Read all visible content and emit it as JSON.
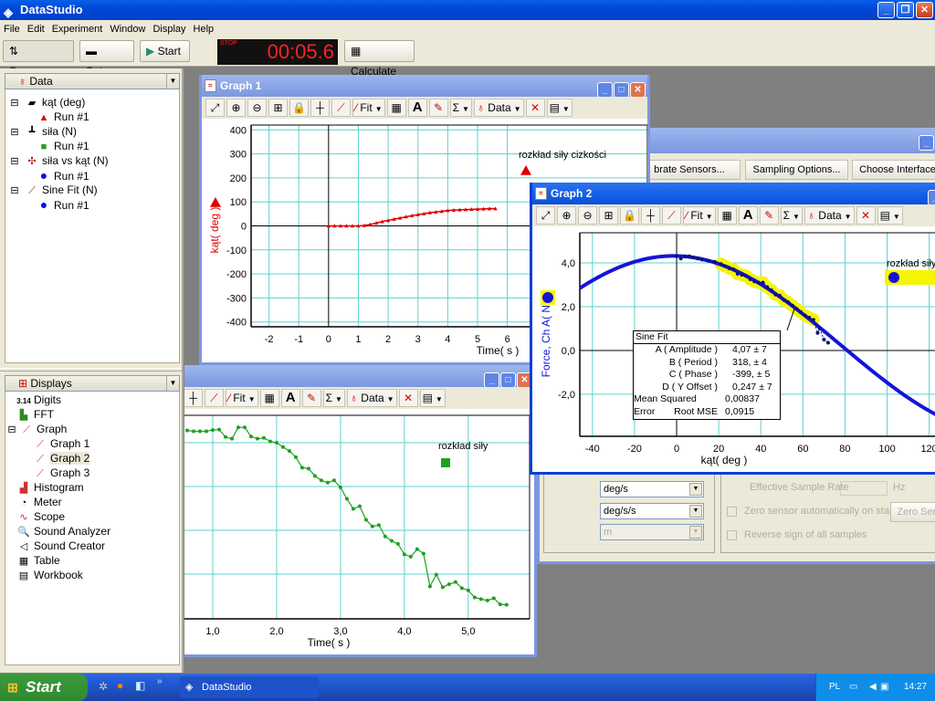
{
  "app": {
    "title": "DataStudio"
  },
  "menu": [
    "File",
    "Edit",
    "Experiment",
    "Window",
    "Display",
    "Help"
  ],
  "toolbar": {
    "summary": "Summary",
    "setup": "Setup",
    "start": "Start",
    "timer": "00:05.6",
    "timer_state": "STOP",
    "calculate": "Calculate"
  },
  "data_panel": {
    "header": "Data",
    "items": [
      {
        "label": "kąt (deg)",
        "icon": "rotary-sensor-icon",
        "run": "Run #1",
        "marker": "triangle",
        "color": "#e00000"
      },
      {
        "label": "siła (N)",
        "icon": "force-sensor-icon",
        "run": "Run #1",
        "marker": "square",
        "color": "#20a020"
      },
      {
        "label": "siła vs kąt (N)",
        "icon": "xy-calc-icon",
        "run": "Run #1",
        "marker": "circle",
        "color": "#1010e0"
      },
      {
        "label": "Sine Fit (N)",
        "icon": "fit-icon",
        "run": "Run #1",
        "marker": "circle",
        "color": "#1010e0"
      }
    ]
  },
  "displays_panel": {
    "header": "Displays",
    "items": [
      "Digits",
      "FFT",
      "Graph",
      "Graph 1",
      "Graph 2",
      "Graph 3",
      "Histogram",
      "Meter",
      "Scope",
      "Sound Analyzer",
      "Sound Creator",
      "Table",
      "Workbook"
    ],
    "digits_icon_text": "3.14",
    "selected": "Graph 2"
  },
  "graph_toolbar": [
    {
      "name": "scale-to-fit-icon",
      "glyph": "⤢"
    },
    {
      "name": "zoom-in-icon",
      "glyph": "⊕"
    },
    {
      "name": "zoom-out-icon",
      "glyph": "⊖"
    },
    {
      "name": "zoom-select-icon",
      "glyph": "⊞"
    },
    {
      "name": "data-lock-icon",
      "glyph": "🔒"
    },
    {
      "name": "smart-tool-icon",
      "glyph": "┼"
    },
    {
      "name": "slope-tool-icon",
      "glyph": "⟋"
    },
    {
      "name": "fit-icon",
      "glyph": "⁄",
      "label": "Fit",
      "dropdown": true
    },
    {
      "name": "calculator-icon",
      "glyph": "▦"
    },
    {
      "name": "text-note-icon",
      "glyph": "A"
    },
    {
      "name": "annotation-pen-icon",
      "glyph": "✎"
    },
    {
      "name": "statistics-icon",
      "glyph": "Σ",
      "dropdown": true
    },
    {
      "name": "data-icon",
      "glyph": "♁",
      "label": "Data",
      "dropdown": true
    },
    {
      "name": "delete-icon",
      "glyph": "✕"
    },
    {
      "name": "graph-settings-icon",
      "glyph": "▤",
      "dropdown": true
    }
  ],
  "graph1": {
    "title": "Graph 1"
  },
  "graph2": {
    "title": "Graph 2",
    "fit_box": {
      "title": "Sine Fit",
      "rows": [
        {
          "label": "A ( Amplitude )",
          "value": "4,07 ±  7"
        },
        {
          "label": "B ( Period )",
          "value": "318, ± 4"
        },
        {
          "label": "C ( Phase )",
          "value": "-399, ± 5"
        },
        {
          "label": "D ( Y Offset )",
          "value": "0,247 ±  7"
        },
        {
          "label": "Mean Squared Error",
          "value": "0,00837"
        },
        {
          "label": "Root MSE",
          "value": "0,0915"
        }
      ]
    }
  },
  "setup_window": {
    "buttons": [
      "brate Sensors...",
      "Sampling Options...",
      "Choose Interface"
    ],
    "units": [
      {
        "value": "deg/s",
        "enabled": true
      },
      {
        "value": "deg/s/s",
        "enabled": true
      },
      {
        "value": "m",
        "enabled": false
      }
    ],
    "sample_rate_label": "Effective Sample Rate",
    "sample_rate_unit": "Hz",
    "zero_on_start": "Zero sensor automatically on start",
    "reverse_sign": "Reverse sign of all samples",
    "zero_button": "Zero Sen"
  },
  "taskbar": {
    "start": "Start",
    "task": "DataStudio",
    "lang": "PL",
    "clock": "14:27"
  },
  "colors": {
    "grid": "#5fd0d0",
    "red": "#e00000",
    "blue": "#1414d8",
    "green": "#20a020",
    "highlight": "#f5f500",
    "title_active": "#0850dc"
  },
  "chart_data": [
    {
      "type": "line",
      "window": "Graph 1",
      "xlabel": "Time( s )",
      "ylabel": "kąt( deg )",
      "xlim": [
        -2.6,
        10.7
      ],
      "ylim": [
        -420,
        420
      ],
      "xticks": [
        -2,
        -1,
        0,
        1,
        2,
        3,
        4,
        5,
        6
      ],
      "xticklabels": [
        "-2",
        "-1",
        "0",
        "1",
        "2",
        "3",
        "4",
        "5",
        "6"
      ],
      "yticks": [
        -400,
        -300,
        -200,
        -100,
        0,
        100,
        200,
        300,
        400
      ],
      "yticklabels": [
        "-400",
        "-300",
        "-200",
        "-100",
        "0",
        "100",
        "200",
        "300",
        "400"
      ],
      "grid": true,
      "legend": "top-right",
      "series": [
        {
          "name": "rozkład siły cizkości",
          "marker": "triangle",
          "color": "#e00000",
          "x": [
            0,
            0.2,
            0.4,
            0.6,
            0.8,
            1.0,
            1.2,
            1.4,
            1.6,
            1.8,
            2.0,
            2.2,
            2.4,
            2.6,
            2.8,
            3.0,
            3.2,
            3.4,
            3.6,
            3.8,
            4.0,
            4.2,
            4.4,
            4.6,
            4.8,
            5.0,
            5.2,
            5.4,
            5.6
          ],
          "y": [
            0,
            0,
            0,
            0,
            0,
            0,
            2,
            6,
            12,
            18,
            23,
            28,
            33,
            38,
            43,
            47,
            51,
            55,
            58,
            61,
            64,
            66,
            67,
            68,
            69,
            70,
            71,
            72,
            72
          ]
        }
      ]
    },
    {
      "type": "scatter",
      "window": "Graph 2",
      "xlabel": "kąt( deg )",
      "ylabel": "Force, Ch A( N )",
      "xlim": [
        -46,
        124.5
      ],
      "ylim": [
        -3.92,
        5.375
      ],
      "xticks": [
        -40,
        -20,
        0,
        20,
        40,
        60,
        80,
        100,
        120
      ],
      "xticklabels": [
        "-40",
        "-20",
        "0",
        "20",
        "40",
        "60",
        "80",
        "100",
        "120"
      ],
      "yticks": [
        -2,
        0,
        2,
        4
      ],
      "yticklabels": [
        "-2,0",
        "0,0",
        "2,0",
        "4,0"
      ],
      "grid": true,
      "legend": "top-right",
      "highlight_x_range": [
        20,
        65
      ],
      "series": [
        {
          "name": "rozkład siły",
          "marker": "circle",
          "color": "#1414d8",
          "x": [
            0,
            2,
            4,
            6,
            8,
            10,
            12,
            15,
            18,
            21,
            23,
            25,
            27,
            29,
            31,
            33,
            35,
            37,
            39,
            41,
            43,
            45,
            47,
            49,
            51,
            53,
            55,
            57,
            59,
            61,
            63,
            65,
            67,
            68,
            70,
            72
          ],
          "y": [
            4.3,
            4.2,
            4.3,
            4.3,
            4.25,
            4.2,
            4.15,
            4.1,
            4.05,
            3.95,
            3.85,
            3.75,
            3.7,
            3.5,
            3.45,
            3.4,
            3.25,
            3.15,
            3.1,
            3.1,
            2.9,
            2.75,
            2.55,
            2.5,
            2.3,
            2.2,
            2.05,
            1.9,
            1.75,
            1.6,
            1.5,
            1.4,
            0.8,
            1.0,
            0.5,
            0.35
          ]
        }
      ],
      "fit": {
        "name": "Sine Fit",
        "A": 4.07,
        "B": 318,
        "C": -399,
        "D": 0.247
      }
    },
    {
      "type": "line",
      "window": "Graph 3",
      "xlabel": "Time( s )",
      "ylabel": "",
      "xlim": [
        0.557,
        5.96
      ],
      "ylim": [
        -0.02,
        4.625
      ],
      "xticks": [
        1,
        2,
        3,
        4,
        5
      ],
      "xticklabels": [
        "1,0",
        "2,0",
        "3,0",
        "4,0",
        "5,0"
      ],
      "ygrid": [
        1,
        2,
        3,
        4
      ],
      "grid": true,
      "legend": "top-right",
      "series": [
        {
          "name": "rozkład siły",
          "marker": "circle",
          "color": "#20a020",
          "x": [
            0.6,
            0.7,
            0.8,
            0.9,
            1.0,
            1.1,
            1.2,
            1.3,
            1.4,
            1.5,
            1.6,
            1.7,
            1.8,
            1.9,
            2.0,
            2.1,
            2.2,
            2.3,
            2.4,
            2.5,
            2.6,
            2.7,
            2.8,
            2.9,
            3.0,
            3.1,
            3.2,
            3.3,
            3.4,
            3.5,
            3.6,
            3.7,
            3.8,
            3.9,
            4.0,
            4.1,
            4.2,
            4.3,
            4.4,
            4.5,
            4.6,
            4.7,
            4.8,
            4.9,
            5.0,
            5.1,
            5.2,
            5.3,
            5.4,
            5.5,
            5.6
          ],
          "y": [
            4.28,
            4.26,
            4.26,
            4.26,
            4.29,
            4.3,
            4.13,
            4.09,
            4.35,
            4.35,
            4.14,
            4.09,
            4.11,
            4.03,
            4.0,
            3.9,
            3.81,
            3.67,
            3.43,
            3.41,
            3.24,
            3.14,
            3.09,
            3.14,
            2.98,
            2.72,
            2.49,
            2.55,
            2.24,
            2.09,
            2.12,
            1.86,
            1.76,
            1.69,
            1.45,
            1.4,
            1.57,
            1.47,
            0.72,
            0.99,
            0.7,
            0.77,
            0.82,
            0.68,
            0.63,
            0.47,
            0.43,
            0.4,
            0.45,
            0.31,
            0.3
          ]
        }
      ]
    }
  ]
}
